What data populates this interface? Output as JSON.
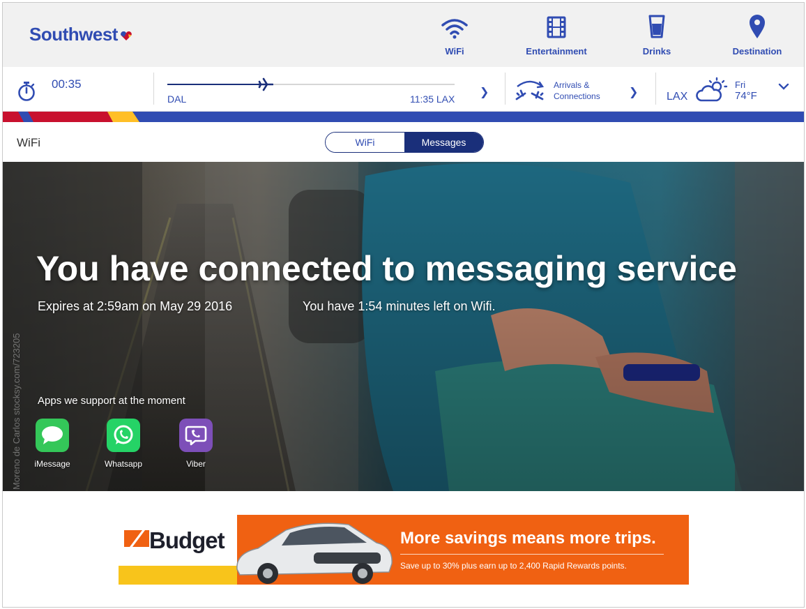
{
  "brand": {
    "name": "Southwest",
    "primary_color": "#304cb2",
    "navy": "#1a2f7a",
    "red": "#c8102e",
    "gold": "#ffbf27"
  },
  "top_nav": {
    "items": [
      {
        "label": "WiFi",
        "icon": "wifi-icon"
      },
      {
        "label": "Entertainment",
        "icon": "film-icon"
      },
      {
        "label": "Drinks",
        "icon": "cup-icon"
      },
      {
        "label": "Destination",
        "icon": "location-pin-icon"
      }
    ]
  },
  "flight": {
    "elapsed": "00:35",
    "origin": "DAL",
    "arrival": "11:35 LAX",
    "progress": 0.34,
    "arrivals_label": "Arrivals & Connections",
    "destination": "LAX",
    "weather_day": "Fri",
    "weather_temp": "74°F"
  },
  "section": {
    "title": "WiFi",
    "toggle": {
      "options": [
        "WiFi",
        "Messages"
      ],
      "selected": "Messages"
    }
  },
  "hero": {
    "headline": "You have connected to messaging service",
    "expiry": "Expires at 2:59am on May 29 2016",
    "remaining": "You have 1:54 minutes left on Wifi.",
    "photo_credit": "Moreno de Carlos  stocksy.com/723205",
    "apps_heading": "Apps we support at the moment",
    "apps": [
      {
        "name": "iMessage",
        "color": "#34c759",
        "icon": "imessage-icon"
      },
      {
        "name": "Whatsapp",
        "color": "#25d366",
        "icon": "whatsapp-icon"
      },
      {
        "name": "Viber",
        "color": "#7d4fb8",
        "icon": "viber-icon"
      }
    ]
  },
  "ad": {
    "brand": "Budget",
    "headline": "More savings means more trips.",
    "subtext": "Save up to 30% plus earn up to 2,400 Rapid Rewards points.",
    "colors": {
      "orange": "#f06112",
      "yellow": "#f8c41b"
    }
  }
}
